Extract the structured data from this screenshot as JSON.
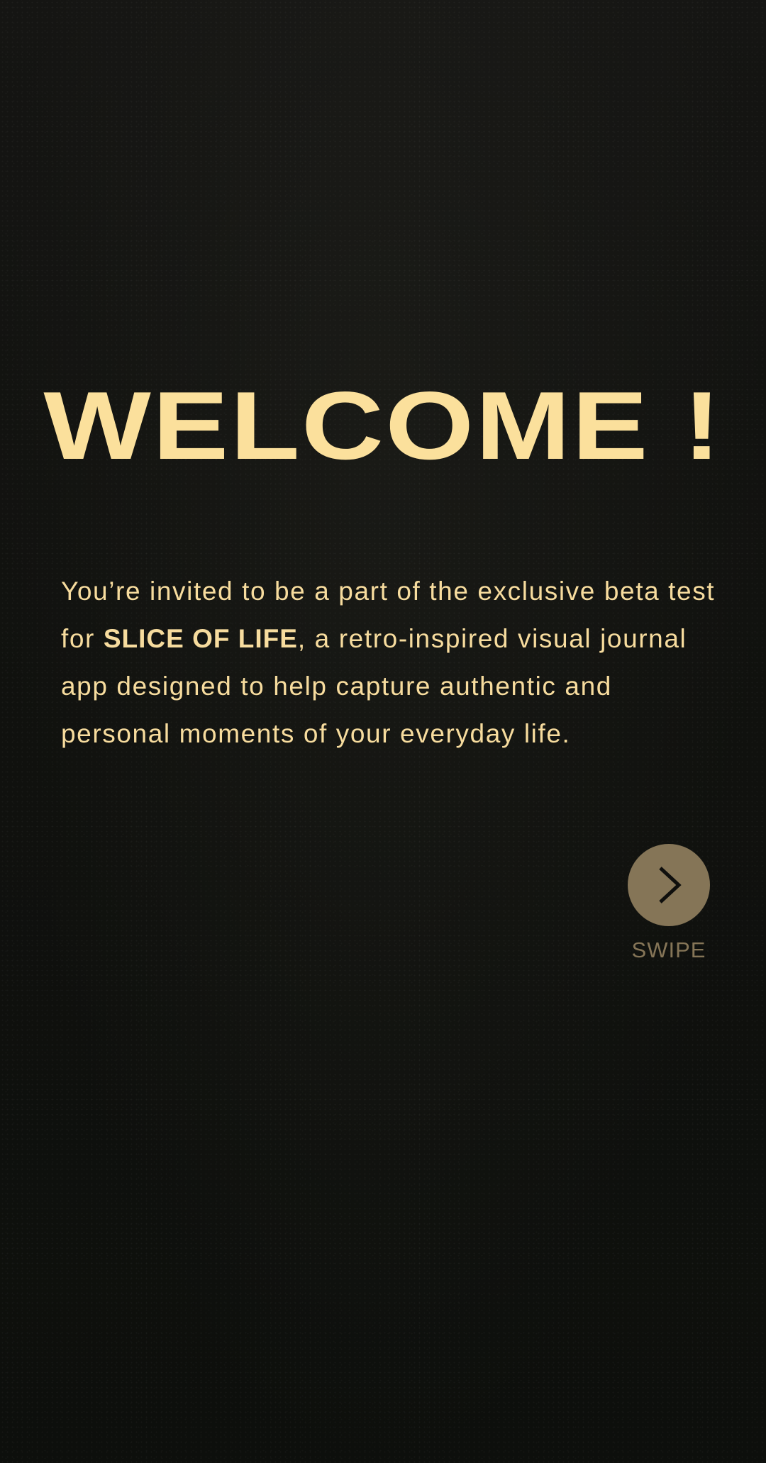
{
  "welcome": {
    "title": "WELCOME !"
  },
  "intro": {
    "before": "You’re invited to be a part of the exclusive beta test for ",
    "brand": "SLICE OF LIFE",
    "after": ", a retro-inspired visual journal app designed to help capture authentic and personal moments of your everyday life."
  },
  "swipe": {
    "icon": "chevron-right-icon",
    "label": "SWIPE"
  },
  "colors": {
    "background": "#121210",
    "accent": "#fbe09c",
    "button": "#857557"
  }
}
